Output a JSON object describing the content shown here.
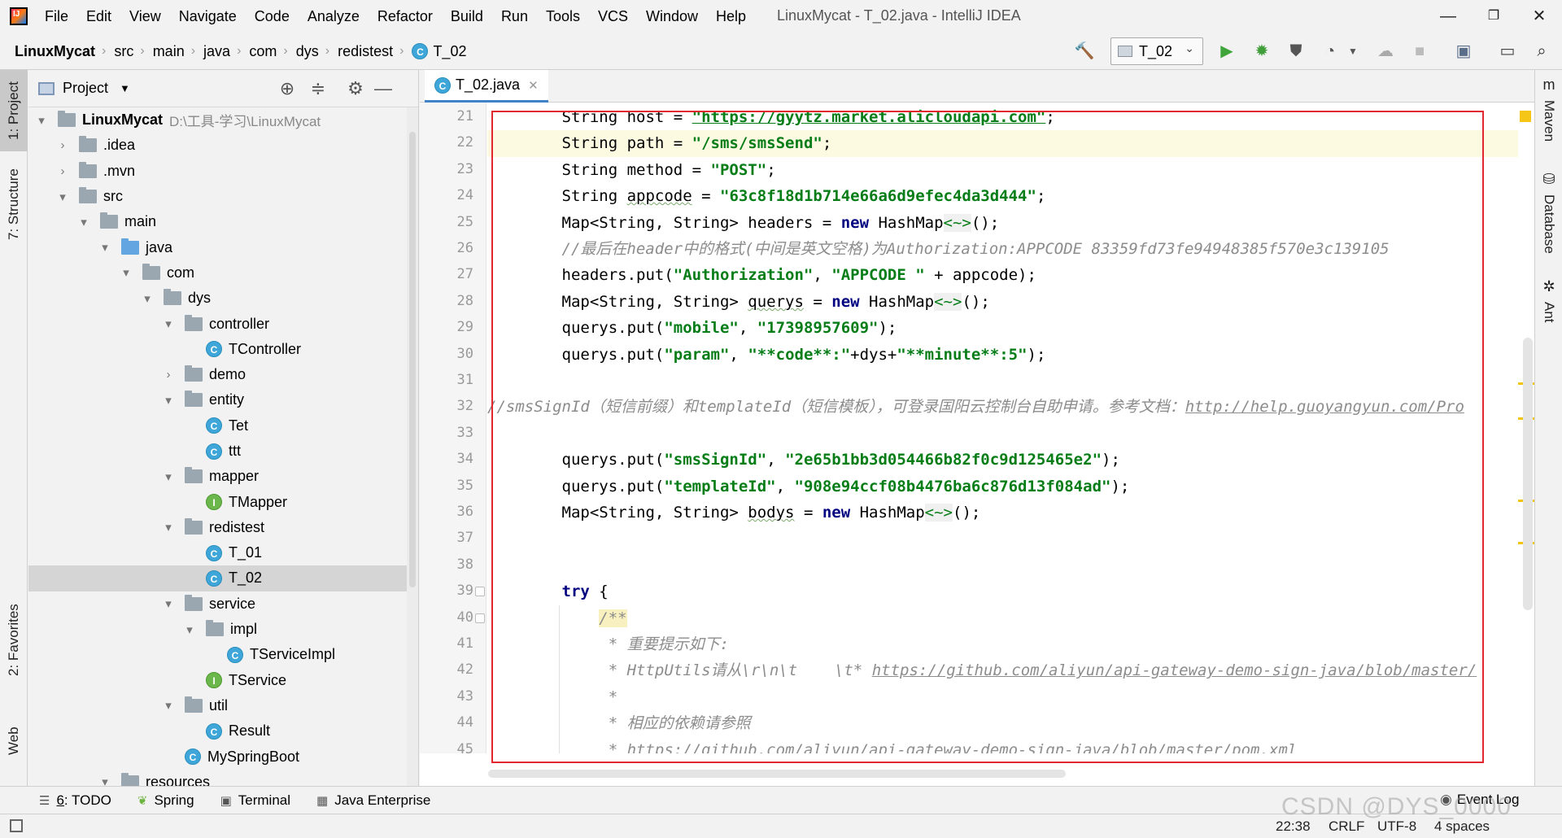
{
  "menubar": {
    "items": [
      "File",
      "Edit",
      "View",
      "Navigate",
      "Code",
      "Analyze",
      "Refactor",
      "Build",
      "Run",
      "Tools",
      "VCS",
      "Window",
      "Help"
    ],
    "window_title": "LinuxMycat - T_02.java - IntelliJ IDEA",
    "minimize": "—",
    "restore": "❐",
    "close": "✕"
  },
  "breadcrumb": [
    "LinuxMycat",
    "src",
    "main",
    "java",
    "com",
    "dys",
    "redistest",
    "T_02"
  ],
  "toolbar": {
    "run_config": "T_02",
    "icons": [
      "hammer-icon",
      "run-icon",
      "debug-icon",
      "coverage-icon",
      "profile-icon",
      "attach-icon",
      "stop-icon",
      "project-structure-icon",
      "layout-icon",
      "search-icon"
    ]
  },
  "left_stripe": {
    "project": "1: Project",
    "structure": "7: Structure",
    "favorites": "2: Favorites",
    "web": "Web"
  },
  "right_stripe": {
    "maven": "Maven",
    "database": "Database",
    "ant": "Ant"
  },
  "project_panel": {
    "title": "Project",
    "tree": [
      {
        "label": "LinuxMycat",
        "path": "D:\\工具-学习\\LinuxMycat",
        "arrow": "▾",
        "icon": "module",
        "bold": true
      },
      {
        "label": ".idea",
        "arrow": "›",
        "icon": "folder"
      },
      {
        "label": ".mvn",
        "arrow": "›",
        "icon": "folder"
      },
      {
        "label": "src",
        "arrow": "▾",
        "icon": "folder"
      },
      {
        "label": "main",
        "arrow": "▾",
        "icon": "folder"
      },
      {
        "label": "java",
        "arrow": "▾",
        "icon": "folder-blue"
      },
      {
        "label": "com",
        "arrow": "▾",
        "icon": "folder"
      },
      {
        "label": "dys",
        "arrow": "▾",
        "icon": "folder"
      },
      {
        "label": "controller",
        "arrow": "▾",
        "icon": "folder"
      },
      {
        "label": "TController",
        "arrow": "",
        "icon": "class",
        "badge": "C"
      },
      {
        "label": "demo",
        "arrow": "›",
        "icon": "folder"
      },
      {
        "label": "entity",
        "arrow": "▾",
        "icon": "folder"
      },
      {
        "label": "Tet",
        "arrow": "",
        "icon": "class",
        "badge": "C"
      },
      {
        "label": "ttt",
        "arrow": "",
        "icon": "class",
        "badge": "C"
      },
      {
        "label": "mapper",
        "arrow": "▾",
        "icon": "folder"
      },
      {
        "label": "TMapper",
        "arrow": "",
        "icon": "interface",
        "badge": "I"
      },
      {
        "label": "redistest",
        "arrow": "▾",
        "icon": "folder"
      },
      {
        "label": "T_01",
        "arrow": "",
        "icon": "class",
        "badge": "C"
      },
      {
        "label": "T_02",
        "arrow": "",
        "icon": "class",
        "badge": "C",
        "selected": true
      },
      {
        "label": "service",
        "arrow": "▾",
        "icon": "folder"
      },
      {
        "label": "impl",
        "arrow": "▾",
        "icon": "folder"
      },
      {
        "label": "TServiceImpl",
        "arrow": "",
        "icon": "class",
        "badge": "C"
      },
      {
        "label": "TService",
        "arrow": "",
        "icon": "interface",
        "badge": "I"
      },
      {
        "label": "util",
        "arrow": "▾",
        "icon": "folder"
      },
      {
        "label": "Result",
        "arrow": "",
        "icon": "class",
        "badge": "C"
      },
      {
        "label": "MySpringBoot",
        "arrow": "",
        "icon": "class",
        "badge": "C"
      },
      {
        "label": "resources",
        "arrow": "▾",
        "icon": "folder"
      }
    ]
  },
  "editor": {
    "tab": "T_02.java",
    "line_numbers": [
      "21",
      "22",
      "23",
      "24",
      "25",
      "26",
      "27",
      "28",
      "29",
      "30",
      "31",
      "32",
      "33",
      "34",
      "35",
      "36",
      "37",
      "38",
      "39",
      "40",
      "41",
      "42",
      "43",
      "44",
      "45"
    ],
    "lines": [
      [
        {
          "t": "        String host = ",
          "c": ""
        },
        {
          "t": "\"https://gyytz.market.alicloudapi.com\"",
          "c": "url"
        },
        {
          "t": ";",
          "c": ""
        }
      ],
      [
        {
          "t": "        String path = ",
          "c": ""
        },
        {
          "t": "\"/sms/smsSend\"",
          "c": "str"
        },
        {
          "t": ";",
          "c": ""
        }
      ],
      [
        {
          "t": "        String method = ",
          "c": ""
        },
        {
          "t": "\"POST\"",
          "c": "str"
        },
        {
          "t": ";",
          "c": ""
        }
      ],
      [
        {
          "t": "        String ",
          "c": ""
        },
        {
          "t": "appcode",
          "c": "typo"
        },
        {
          "t": " = ",
          "c": ""
        },
        {
          "t": "\"63c8f18d1b714e66a6d9efec4da3d444\"",
          "c": "str"
        },
        {
          "t": ";",
          "c": ""
        }
      ],
      [
        {
          "t": "        Map<String, String> headers = ",
          "c": ""
        },
        {
          "t": "new",
          "c": "kw"
        },
        {
          "t": " HashMap",
          "c": ""
        },
        {
          "t": "<~>",
          "c": "diamond"
        },
        {
          "t": "();",
          "c": ""
        }
      ],
      [
        {
          "t": "        //最后在header中的格式(中间是英文空格)为Authorization:APPCODE 83359fd73fe94948385f570e3c139105",
          "c": "cmt"
        }
      ],
      [
        {
          "t": "        headers.put(",
          "c": ""
        },
        {
          "t": "\"Authorization\"",
          "c": "str"
        },
        {
          "t": ", ",
          "c": ""
        },
        {
          "t": "\"APPCODE \"",
          "c": "str"
        },
        {
          "t": " + appcode);",
          "c": ""
        }
      ],
      [
        {
          "t": "        Map<String, String> ",
          "c": ""
        },
        {
          "t": "querys",
          "c": "typo"
        },
        {
          "t": " = ",
          "c": ""
        },
        {
          "t": "new",
          "c": "kw"
        },
        {
          "t": " HashMap",
          "c": ""
        },
        {
          "t": "<~>",
          "c": "diamond"
        },
        {
          "t": "();",
          "c": ""
        }
      ],
      [
        {
          "t": "        querys.put(",
          "c": ""
        },
        {
          "t": "\"mobile\"",
          "c": "str"
        },
        {
          "t": ", ",
          "c": ""
        },
        {
          "t": "\"17398957609\"",
          "c": "str"
        },
        {
          "t": ");",
          "c": ""
        }
      ],
      [
        {
          "t": "        querys.put(",
          "c": ""
        },
        {
          "t": "\"param\"",
          "c": "str"
        },
        {
          "t": ", ",
          "c": ""
        },
        {
          "t": "\"**code**:\"",
          "c": "str"
        },
        {
          "t": "+dys+",
          "c": ""
        },
        {
          "t": "\"**minute**:5\"",
          "c": "str"
        },
        {
          "t": ");",
          "c": ""
        }
      ],
      [
        {
          "t": "",
          "c": ""
        }
      ],
      [
        {
          "t": "//smsSignId（短信前缀）和templateId（短信模板），可登录国阳云控制台自助申请。参考文档：",
          "c": "cmt"
        },
        {
          "t": "http://help.guoyangyun.com/Pro",
          "c": "cmt-url"
        }
      ],
      [
        {
          "t": "",
          "c": ""
        }
      ],
      [
        {
          "t": "        querys.put(",
          "c": ""
        },
        {
          "t": "\"smsSignId\"",
          "c": "str"
        },
        {
          "t": ", ",
          "c": ""
        },
        {
          "t": "\"2e65b1bb3d054466b82f0c9d125465e2\"",
          "c": "str"
        },
        {
          "t": ");",
          "c": ""
        }
      ],
      [
        {
          "t": "        querys.put(",
          "c": ""
        },
        {
          "t": "\"templateId\"",
          "c": "str"
        },
        {
          "t": ", ",
          "c": ""
        },
        {
          "t": "\"908e94ccf08b4476ba6c876d13f084ad\"",
          "c": "str"
        },
        {
          "t": ");",
          "c": ""
        }
      ],
      [
        {
          "t": "        Map<String, String> ",
          "c": ""
        },
        {
          "t": "bodys",
          "c": "typo"
        },
        {
          "t": " = ",
          "c": ""
        },
        {
          "t": "new",
          "c": "kw"
        },
        {
          "t": " HashMap",
          "c": ""
        },
        {
          "t": "<~>",
          "c": "diamond"
        },
        {
          "t": "();",
          "c": ""
        }
      ],
      [
        {
          "t": "",
          "c": ""
        }
      ],
      [
        {
          "t": "",
          "c": ""
        }
      ],
      [
        {
          "t": "        ",
          "c": ""
        },
        {
          "t": "try",
          "c": "kw"
        },
        {
          "t": " {",
          "c": ""
        }
      ],
      [
        {
          "t": "            ",
          "c": ""
        },
        {
          "t": "/**",
          "c": "doc-start"
        }
      ],
      [
        {
          "t": "             * 重要提示如下:",
          "c": "doc"
        }
      ],
      [
        {
          "t": "             * HttpUtils请从\\r\\n\\t    \\t* ",
          "c": "doc"
        },
        {
          "t": "https://github.com/aliyun/api-gateway-demo-sign-java/blob/master/",
          "c": "cmt-url"
        }
      ],
      [
        {
          "t": "             *",
          "c": "doc"
        }
      ],
      [
        {
          "t": "             * 相应的依赖请参照",
          "c": "doc"
        }
      ],
      [
        {
          "t": "             * ",
          "c": "doc"
        },
        {
          "t": "https://github.com/aliyun/api-gateway-demo-sign-java/blob/master/pom.xml",
          "c": "cmt-url"
        }
      ]
    ]
  },
  "bottom_tools": {
    "todo_num": "6",
    "todo": ": TODO",
    "spring": "Spring",
    "terminal": "Terminal",
    "java_enterprise": "Java Enterprise",
    "event_log": "Event Log"
  },
  "status": {
    "position": "22:38",
    "line_sep": "CRLF",
    "encoding": "UTF-8",
    "indent": "4 spaces"
  },
  "watermark": "CSDN @DYS_0000"
}
